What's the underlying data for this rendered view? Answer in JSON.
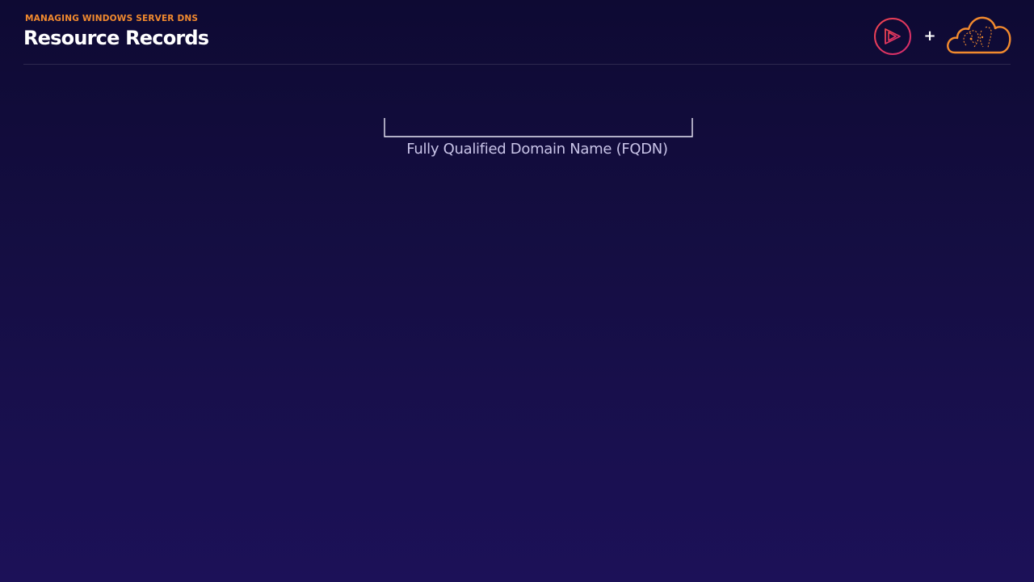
{
  "header": {
    "kicker": "MANAGING WINDOWS SERVER DNS",
    "title": "Resource Records",
    "plus_symbol": "+",
    "logos": {
      "play_icon": "play-circle-icon",
      "cloud_icon": "cloud-logo-icon"
    }
  },
  "diagram": {
    "bracket_label": "Fully Qualified Domain Name (FQDN)"
  },
  "colors": {
    "accent_orange": "#f28a2e",
    "accent_pink": "#e8334f",
    "bg_top": "#0e0a33",
    "bg_bottom": "#1c1158"
  }
}
